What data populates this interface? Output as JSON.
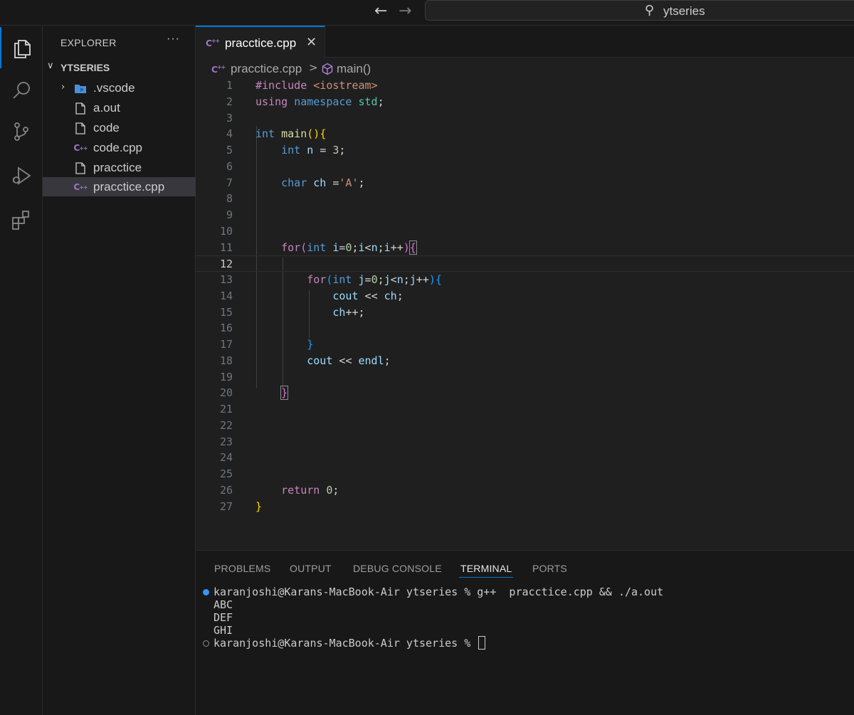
{
  "titlebar": {
    "search_label": "ytseries"
  },
  "activity_bar": {
    "items": [
      {
        "icon": "files-icon",
        "active": true
      },
      {
        "icon": "search-icon",
        "active": false
      },
      {
        "icon": "source-control-icon",
        "active": false
      },
      {
        "icon": "run-debug-icon",
        "active": false
      },
      {
        "icon": "extensions-icon",
        "active": false
      }
    ]
  },
  "sidebar": {
    "title": "EXPLORER",
    "more_label": "···",
    "folder": "YTSERIES",
    "items": [
      {
        "name": ".vscode",
        "icon": "vscode-folder-icon"
      },
      {
        "name": "a.out",
        "icon": "file-icon"
      },
      {
        "name": "code",
        "icon": "file-icon"
      },
      {
        "name": "code.cpp",
        "icon": "cpp-file-icon"
      },
      {
        "name": "pracctice",
        "icon": "file-icon"
      },
      {
        "name": "pracctice.cpp",
        "icon": "cpp-file-icon",
        "selected": true
      }
    ]
  },
  "editor": {
    "tab": {
      "label": "pracctice.cpp",
      "close": "✕"
    },
    "breadcrumb": {
      "file": "pracctice.cpp",
      "separator": ">",
      "symbol": "main()"
    },
    "current_line": 12,
    "lines": [
      {
        "n": "1",
        "text": "#include <iostream>"
      },
      {
        "n": "2",
        "text": "using namespace std;"
      },
      {
        "n": "3",
        "text": ""
      },
      {
        "n": "4",
        "text": "int main(){"
      },
      {
        "n": "5",
        "text": "    int n = 3;"
      },
      {
        "n": "6",
        "text": ""
      },
      {
        "n": "7",
        "text": "    char ch ='A';"
      },
      {
        "n": "8",
        "text": ""
      },
      {
        "n": "9",
        "text": ""
      },
      {
        "n": "10",
        "text": ""
      },
      {
        "n": "11",
        "text": "    for(int i=0;i<n;i++){"
      },
      {
        "n": "12",
        "text": ""
      },
      {
        "n": "13",
        "text": "        for(int j=0;j<n;j++){"
      },
      {
        "n": "14",
        "text": "            cout << ch;"
      },
      {
        "n": "15",
        "text": "            ch++;"
      },
      {
        "n": "16",
        "text": ""
      },
      {
        "n": "17",
        "text": "        }"
      },
      {
        "n": "18",
        "text": "        cout << endl;"
      },
      {
        "n": "19",
        "text": ""
      },
      {
        "n": "20",
        "text": "    }"
      },
      {
        "n": "21",
        "text": ""
      },
      {
        "n": "22",
        "text": ""
      },
      {
        "n": "23",
        "text": ""
      },
      {
        "n": "24",
        "text": ""
      },
      {
        "n": "25",
        "text": ""
      },
      {
        "n": "26",
        "text": "    return 0;"
      },
      {
        "n": "27",
        "text": "}"
      }
    ]
  },
  "panel": {
    "tabs": [
      "PROBLEMS",
      "OUTPUT",
      "DEBUG CONSOLE",
      "TERMINAL",
      "PORTS"
    ],
    "active_tab": "TERMINAL",
    "terminal": [
      "karanjoshi@Karans-MacBook-Air ytseries % g++  pracctice.cpp && ./a.out",
      "ABC",
      "DEF",
      "GHI",
      "karanjoshi@Karans-MacBook-Air ytseries % "
    ]
  },
  "colors": {
    "accent": "#0078d4",
    "keyword": "#c586c0",
    "type": "#569cd6",
    "string": "#ce9178",
    "number": "#b5cea8",
    "variable": "#9cdcfe",
    "function": "#dcdcaa"
  }
}
